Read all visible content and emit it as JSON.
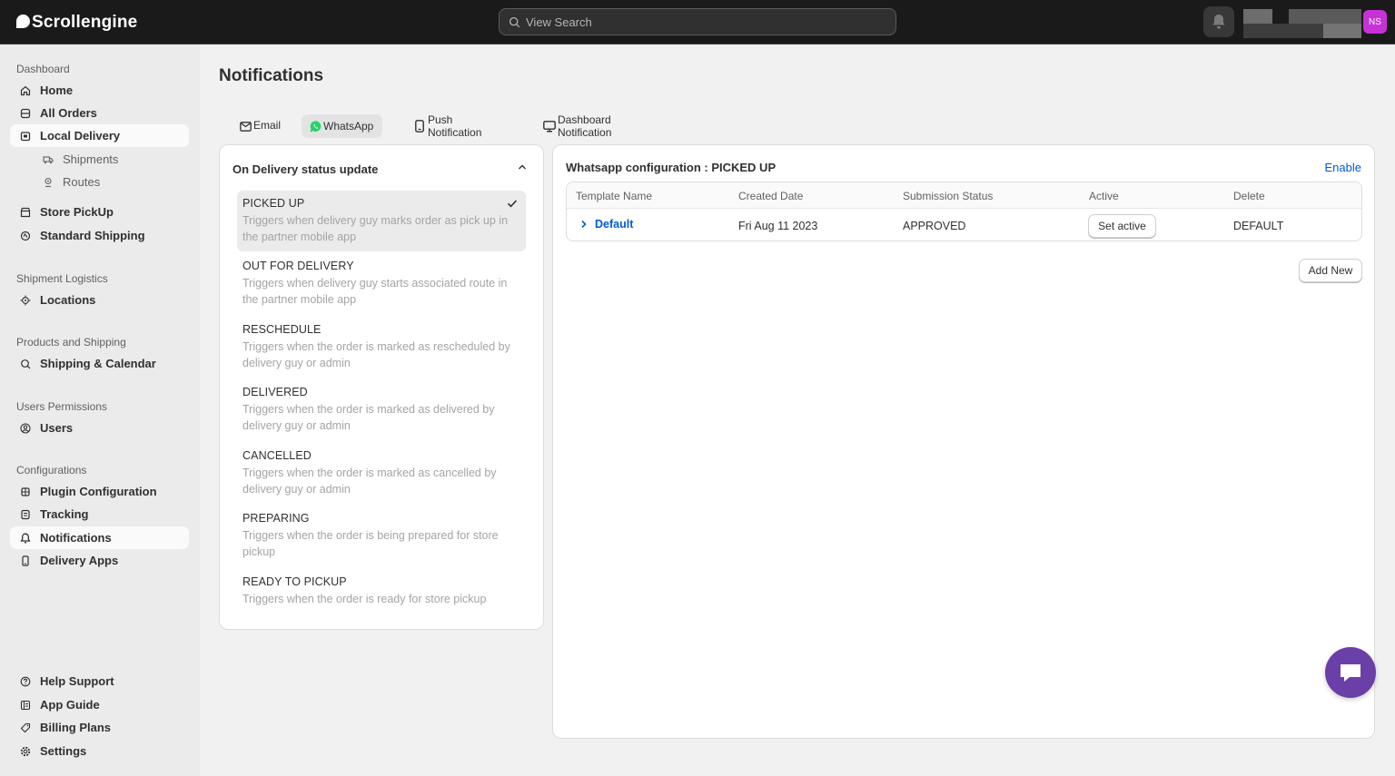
{
  "app": {
    "name": "Scrollengine"
  },
  "search": {
    "placeholder": "View Search"
  },
  "user": {
    "initials": "NS"
  },
  "colors": {
    "accent": "#005bd3",
    "avatar": "#c632d6",
    "chat": "#6a3fa8",
    "topbar": "#1a1a1a"
  },
  "sidebar": {
    "sections": [
      {
        "label": "Dashboard"
      },
      {
        "label": "Shipment Logistics"
      },
      {
        "label": "Products and Shipping"
      },
      {
        "label": "Users Permissions"
      },
      {
        "label": "Configurations"
      }
    ],
    "items": [
      {
        "label": "Home",
        "icon": "home-icon"
      },
      {
        "label": "All Orders",
        "icon": "orders-icon"
      },
      {
        "label": "Local Delivery",
        "icon": "delivery-icon",
        "active": true
      },
      {
        "label": "Shipments",
        "icon": "truck-icon"
      },
      {
        "label": "Routes",
        "icon": "location-pin-icon"
      },
      {
        "label": "Store PickUp",
        "icon": "store-icon"
      },
      {
        "label": "Standard Shipping",
        "icon": "shipping-icon"
      },
      {
        "label": "Locations",
        "icon": "target-icon"
      },
      {
        "label": "Shipping & Calendar",
        "icon": "calendar-search-icon"
      },
      {
        "label": "Users",
        "icon": "user-icon"
      },
      {
        "label": "Plugin Configuration",
        "icon": "plugin-icon"
      },
      {
        "label": "Tracking",
        "icon": "tracking-icon"
      },
      {
        "label": "Notifications",
        "icon": "bell-icon",
        "active": true
      },
      {
        "label": "Delivery Apps",
        "icon": "mobile-icon"
      },
      {
        "label": "Help Support",
        "icon": "help-icon"
      },
      {
        "label": "App Guide",
        "icon": "guide-icon"
      },
      {
        "label": "Billing Plans",
        "icon": "tag-icon"
      },
      {
        "label": "Settings",
        "icon": "gear-icon"
      }
    ]
  },
  "page": {
    "title": "Notifications"
  },
  "tabs": [
    {
      "label": "Email",
      "icon": "mail-icon"
    },
    {
      "label": "WhatsApp",
      "icon": "whatsapp-icon",
      "active": true
    },
    {
      "label": "Push Notification",
      "icon": "mobile-icon"
    },
    {
      "label": "Dashboard Notification",
      "icon": "monitor-icon"
    }
  ],
  "status_panel": {
    "title": "On Delivery status update",
    "items": [
      {
        "title": "PICKED UP",
        "desc": "Triggers when delivery guy marks order as pick up in the partner mobile app",
        "selected": true
      },
      {
        "title": "OUT FOR DELIVERY",
        "desc": "Triggers when delivery guy starts associated route in the partner mobile app"
      },
      {
        "title": "RESCHEDULE",
        "desc": "Triggers when the order is marked as rescheduled by delivery guy or admin"
      },
      {
        "title": "DELIVERED",
        "desc": "Triggers when the order is marked as delivered by delivery guy or admin"
      },
      {
        "title": "CANCELLED",
        "desc": "Triggers when the order is marked as cancelled by delivery guy or admin"
      },
      {
        "title": "PREPARING",
        "desc": "Triggers when the order is being prepared for store pickup"
      },
      {
        "title": "READY TO PICKUP",
        "desc": "Triggers when the order is ready for store pickup"
      }
    ]
  },
  "config": {
    "title": "Whatsapp configuration : PICKED UP",
    "enable_label": "Enable",
    "columns": [
      "Template Name",
      "Created Date",
      "Submission Status",
      "Active",
      "Delete"
    ],
    "rows": [
      {
        "name": "Default",
        "created": "Fri Aug 11 2023",
        "status": "APPROVED",
        "active_label": "Set active",
        "delete": "DEFAULT"
      }
    ],
    "add_new_label": "Add New"
  }
}
